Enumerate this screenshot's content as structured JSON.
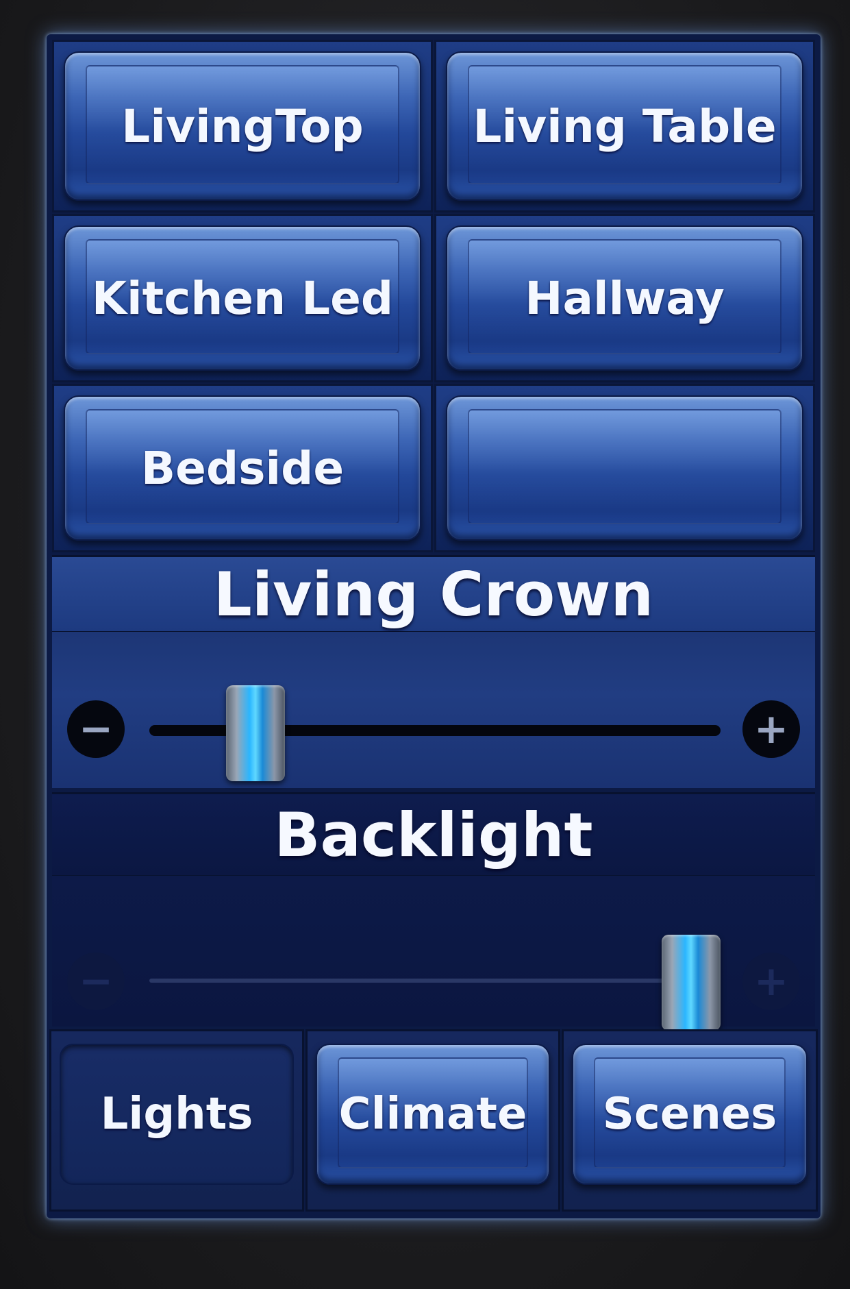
{
  "buttons": [
    {
      "label": "LivingTop"
    },
    {
      "label": "Living Table"
    },
    {
      "label": "Kitchen Led"
    },
    {
      "label": "Hallway"
    },
    {
      "label": "Bedside"
    },
    {
      "label": ""
    }
  ],
  "sliders": [
    {
      "label": "Living Crown",
      "level": 0.15,
      "minus_icon": "minus",
      "plus_icon": "plus"
    },
    {
      "label": "Backlight",
      "level": 1.0,
      "minus_icon": "minus",
      "plus_icon": "plus"
    }
  ],
  "tabs": [
    {
      "label": "Lights",
      "active": true
    },
    {
      "label": "Climate",
      "active": false
    },
    {
      "label": "Scenes",
      "active": false
    }
  ],
  "colors": {
    "accent": "#2ab6ff",
    "panel": "#1a3272",
    "button": "#3d66b6"
  }
}
